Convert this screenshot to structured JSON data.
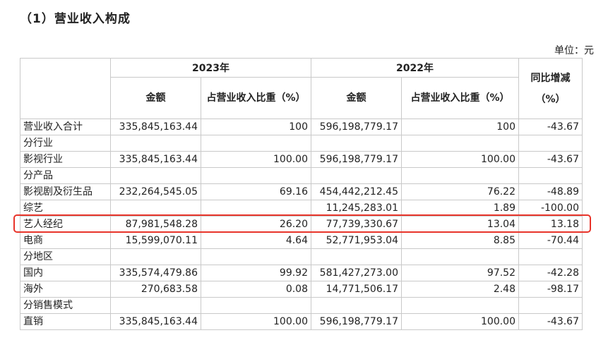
{
  "section_title": "（1）营业收入构成",
  "unit": "单位：元",
  "headers": {
    "year_2023": "2023年",
    "year_2022": "2022年",
    "yoy": "同比增减（%）",
    "amount": "金额",
    "share": "占营业收入比重（%）"
  },
  "rows": [
    {
      "label": "营业收入合计",
      "a2023": "335,845,163.44",
      "p2023": "100",
      "a2022": "596,198,779.17",
      "p2022": "100",
      "yoy": "-43.67"
    },
    {
      "label": "分行业",
      "a2023": "",
      "p2023": "",
      "a2022": "",
      "p2022": "",
      "yoy": ""
    },
    {
      "label": "影视行业",
      "a2023": "335,845,163.44",
      "p2023": "100.00",
      "a2022": "596,198,779.17",
      "p2022": "100.00",
      "yoy": "-43.67"
    },
    {
      "label": "分产品",
      "a2023": "",
      "p2023": "",
      "a2022": "",
      "p2022": "",
      "yoy": ""
    },
    {
      "label": "影视剧及衍生品",
      "a2023": "232,264,545.05",
      "p2023": "69.16",
      "a2022": "454,442,212.45",
      "p2022": "76.22",
      "yoy": "-48.89"
    },
    {
      "label": "综艺",
      "a2023": "",
      "p2023": "",
      "a2022": "11,245,283.01",
      "p2022": "1.89",
      "yoy": "-100.00"
    },
    {
      "label": "艺人经纪",
      "a2023": "87,981,548.28",
      "p2023": "26.20",
      "a2022": "77,739,330.67",
      "p2022": "13.04",
      "yoy": "13.18"
    },
    {
      "label": "电商",
      "a2023": "15,599,070.11",
      "p2023": "4.64",
      "a2022": "52,771,953.04",
      "p2022": "8.85",
      "yoy": "-70.44"
    },
    {
      "label": "分地区",
      "a2023": "",
      "p2023": "",
      "a2022": "",
      "p2022": "",
      "yoy": ""
    },
    {
      "label": "国内",
      "a2023": "335,574,479.86",
      "p2023": "99.92",
      "a2022": "581,427,273.00",
      "p2022": "97.52",
      "yoy": "-42.28"
    },
    {
      "label": "海外",
      "a2023": "270,683.58",
      "p2023": "0.08",
      "a2022": "14,771,506.17",
      "p2022": "2.48",
      "yoy": "-98.17"
    },
    {
      "label": "分销售模式",
      "a2023": "",
      "p2023": "",
      "a2022": "",
      "p2022": "",
      "yoy": ""
    },
    {
      "label": "直销",
      "a2023": "335,845,163.44",
      "p2023": "100.00",
      "a2022": "596,198,779.17",
      "p2022": "100.00",
      "yoy": "-43.67"
    }
  ],
  "highlight_color": "#e8342a"
}
